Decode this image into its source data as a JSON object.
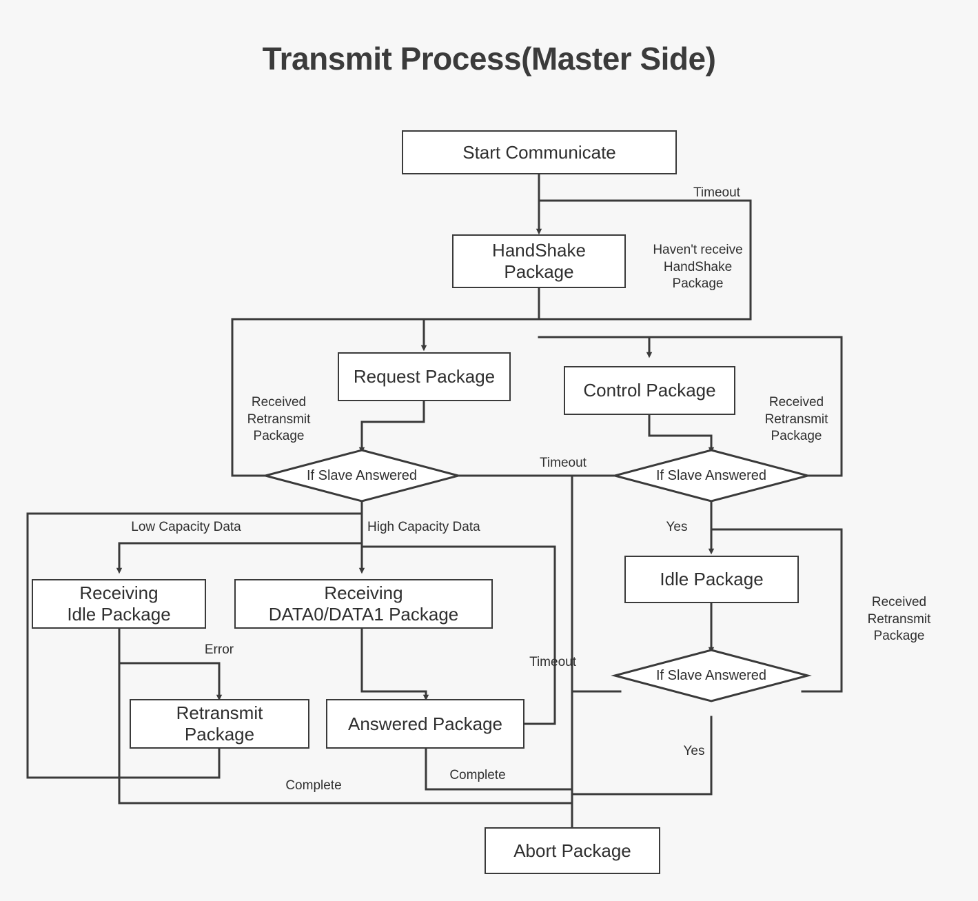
{
  "diagram": {
    "title": "Transmit Process(Master Side)",
    "background_color": "#f7f7f7",
    "node_fill": "#ffffff",
    "line_color": "#3a3a3a",
    "text_color": "#2f2f2f"
  },
  "nodes": [
    {
      "id": "start",
      "label": "Start Communicate",
      "shape": "rect"
    },
    {
      "id": "handshake",
      "label": "HandShake\nPackage",
      "shape": "rect"
    },
    {
      "id": "request",
      "label": "Request Package",
      "shape": "rect"
    },
    {
      "id": "control",
      "label": "Control Package",
      "shape": "rect"
    },
    {
      "id": "dec_left",
      "label": "If Slave Answered",
      "shape": "diamond"
    },
    {
      "id": "dec_right",
      "label": "If Slave Answered",
      "shape": "diamond"
    },
    {
      "id": "recv_idle",
      "label": "Receiving\nIdle Package",
      "shape": "rect"
    },
    {
      "id": "recv_data",
      "label": "Receiving\nDATA0/DATA1 Package",
      "shape": "rect"
    },
    {
      "id": "idle_pkg",
      "label": "Idle Package",
      "shape": "rect"
    },
    {
      "id": "retransmit",
      "label": "Retransmit\nPackage",
      "shape": "rect"
    },
    {
      "id": "answered",
      "label": "Answered Package",
      "shape": "rect"
    },
    {
      "id": "dec_bottom",
      "label": "If Slave Answered",
      "shape": "diamond"
    },
    {
      "id": "abort",
      "label": "Abort Package",
      "shape": "rect"
    }
  ],
  "edge_labels": [
    {
      "id": "timeout_top",
      "text": "Timeout"
    },
    {
      "id": "havent_receive",
      "text": "Haven't receive\nHandShake\nPackage"
    },
    {
      "id": "recv_retx_left",
      "text": "Received\nRetransmit\nPackage"
    },
    {
      "id": "recv_retx_right",
      "text": "Received\nRetransmit\nPackage"
    },
    {
      "id": "timeout_mid",
      "text": "Timeout"
    },
    {
      "id": "low_capacity",
      "text": "Low Capacity Data"
    },
    {
      "id": "high_capacity",
      "text": "High Capacity Data"
    },
    {
      "id": "yes_upper",
      "text": "Yes"
    },
    {
      "id": "recv_retx_bottom",
      "text": "Received\nRetransmit\nPackage"
    },
    {
      "id": "error",
      "text": "Error"
    },
    {
      "id": "timeout_bottom",
      "text": "Timeout"
    },
    {
      "id": "yes_lower",
      "text": "Yes"
    },
    {
      "id": "complete_left",
      "text": "Complete"
    },
    {
      "id": "complete_right",
      "text": "Complete"
    }
  ]
}
